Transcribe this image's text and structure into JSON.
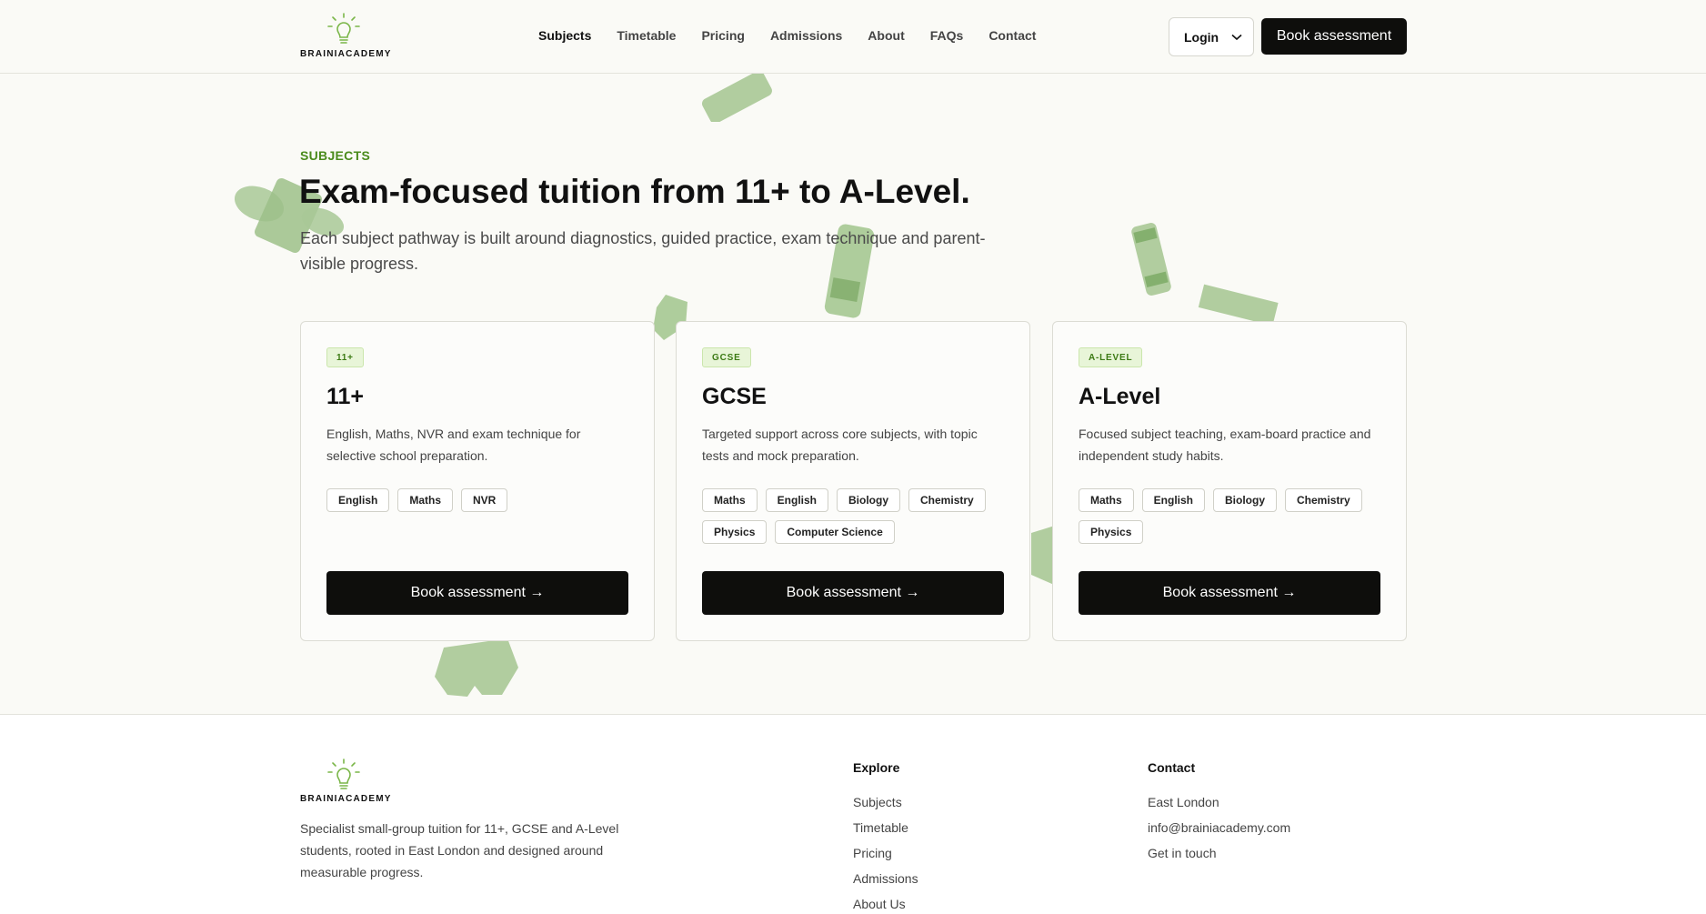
{
  "brand": {
    "name": "BRAINIACADEMY",
    "accent": "#7ab648"
  },
  "nav": {
    "items": [
      "Subjects",
      "Timetable",
      "Pricing",
      "Admissions",
      "About",
      "FAQs",
      "Contact"
    ],
    "active": "Subjects",
    "login_label": "Login",
    "book_label": "Book assessment"
  },
  "hero": {
    "eyebrow": "SUBJECTS",
    "title": "Exam-focused tuition from 11+ to A-Level.",
    "subtitle": "Each subject pathway is built around diagnostics, guided practice, exam technique and parent-visible progress."
  },
  "cards": [
    {
      "badge": "11+",
      "title": "11+",
      "description": "English, Maths, NVR and exam technique for selective school preparation.",
      "tags": [
        "English",
        "Maths",
        "NVR"
      ],
      "cta": "Book assessment →"
    },
    {
      "badge": "GCSE",
      "title": "GCSE",
      "description": "Targeted support across core subjects, with topic tests and mock preparation.",
      "tags": [
        "Maths",
        "English",
        "Biology",
        "Chemistry",
        "Physics",
        "Computer Science"
      ],
      "cta": "Book assessment →"
    },
    {
      "badge": "A-LEVEL",
      "title": "A-Level",
      "description": "Focused subject teaching, exam-board practice and independent study habits.",
      "tags": [
        "Maths",
        "English",
        "Biology",
        "Chemistry",
        "Physics"
      ],
      "cta": "Book assessment →"
    }
  ],
  "footer": {
    "brand": "BRAINIACADEMY",
    "description": "Specialist small-group tuition for 11+, GCSE and A-Level students, rooted in East London and designed around measurable progress.",
    "explore": {
      "heading": "Explore",
      "links": [
        "Subjects",
        "Timetable",
        "Pricing",
        "Admissions",
        "About Us"
      ]
    },
    "contact": {
      "heading": "Contact",
      "links": [
        "East London",
        "info@brainiacademy.com",
        "Get in touch"
      ]
    }
  }
}
